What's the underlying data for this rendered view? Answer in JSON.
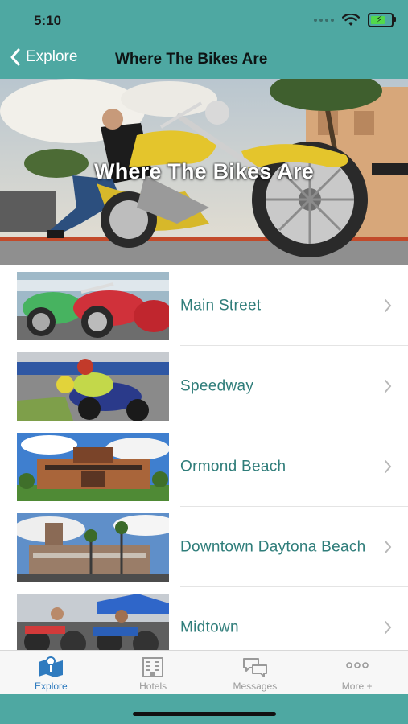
{
  "status": {
    "time": "5:10"
  },
  "nav": {
    "back_label": "Explore",
    "title": "Where The Bikes Are"
  },
  "hero": {
    "title": "Where The Bikes Are"
  },
  "list": {
    "items": [
      {
        "label": "Main Street"
      },
      {
        "label": "Speedway"
      },
      {
        "label": "Ormond Beach"
      },
      {
        "label": "Downtown Daytona Beach"
      },
      {
        "label": "Midtown"
      }
    ]
  },
  "tabbar": {
    "tabs": [
      {
        "label": "Explore",
        "icon": "map-icon",
        "active": true
      },
      {
        "label": "Hotels",
        "icon": "hotel-icon",
        "active": false
      },
      {
        "label": "Messages",
        "icon": "messages-icon",
        "active": false
      },
      {
        "label": "More +",
        "icon": "more-icon",
        "active": false
      }
    ]
  },
  "colors": {
    "accent": "#4ea8a2",
    "link": "#2f7d7a",
    "tab_active": "#2f7bbf"
  }
}
